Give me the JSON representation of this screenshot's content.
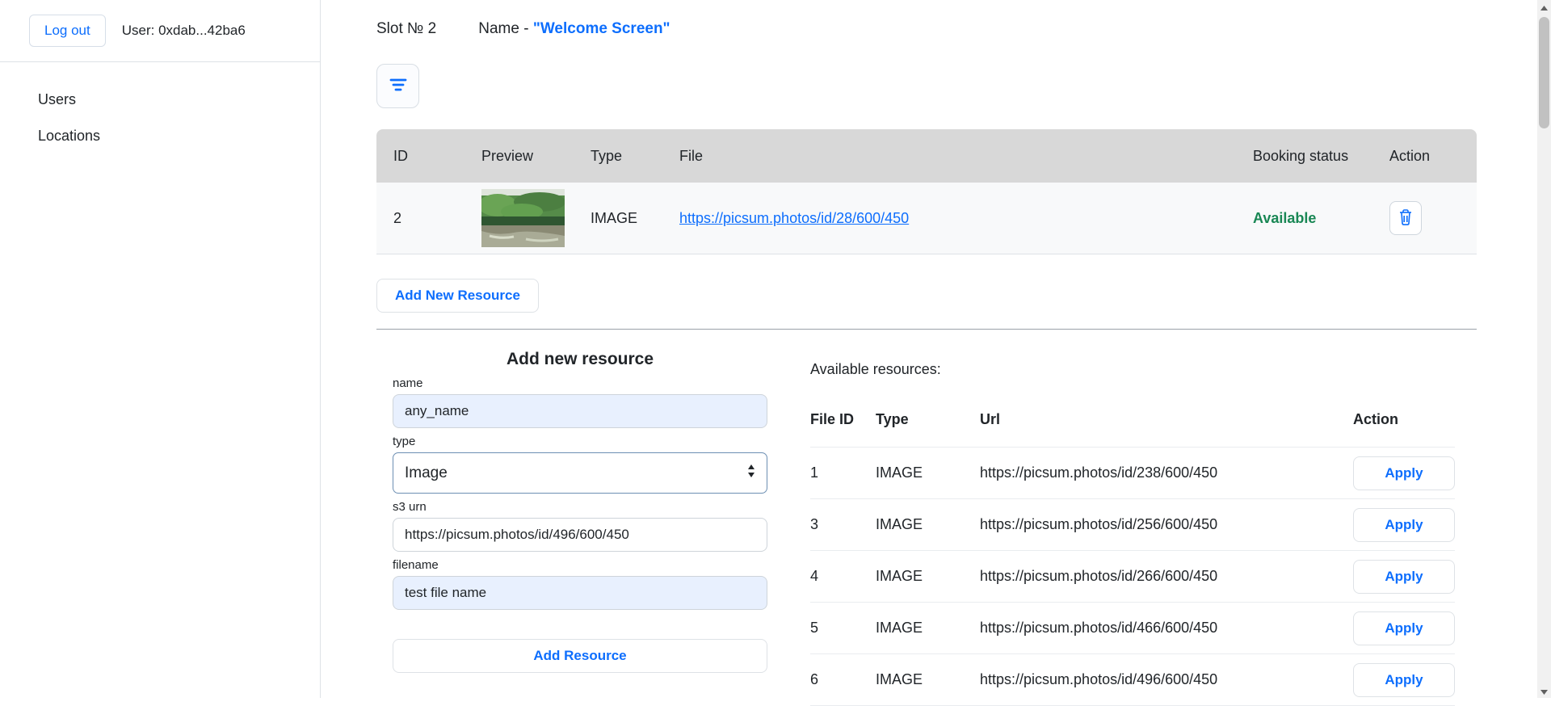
{
  "sidebar": {
    "logout_label": "Log out",
    "user_label": "User: 0xdab...42ba6",
    "items": [
      {
        "label": "Users"
      },
      {
        "label": "Locations"
      }
    ]
  },
  "header": {
    "slot_label": "Slot № 2",
    "name_prefix": "Name - ",
    "name_value": "\"Welcome Screen\""
  },
  "slot_table": {
    "headers": [
      "ID",
      "Preview",
      "Type",
      "File",
      "Booking status",
      "Action"
    ],
    "rows": [
      {
        "id": "2",
        "preview_alt": "forest river photo",
        "type": "IMAGE",
        "file": "https://picsum.photos/id/28/600/450",
        "status": "Available"
      }
    ]
  },
  "actions": {
    "add_new_resource_label": "Add New Resource"
  },
  "form": {
    "title": "Add new resource",
    "name_label": "name",
    "name_value": "any_name",
    "type_label": "type",
    "type_value": "Image",
    "s3_label": "s3 urn",
    "s3_value": "https://picsum.photos/id/496/600/450",
    "filename_label": "filename",
    "filename_value": "test file name",
    "submit_label": "Add Resource"
  },
  "available": {
    "title": "Available resources:",
    "headers": [
      "File ID",
      "Type",
      "Url",
      "Action"
    ],
    "apply_label": "Apply",
    "rows": [
      {
        "file_id": "1",
        "type": "IMAGE",
        "url": "https://picsum.photos/id/238/600/450"
      },
      {
        "file_id": "3",
        "type": "IMAGE",
        "url": "https://picsum.photos/id/256/600/450"
      },
      {
        "file_id": "4",
        "type": "IMAGE",
        "url": "https://picsum.photos/id/266/600/450"
      },
      {
        "file_id": "5",
        "type": "IMAGE",
        "url": "https://picsum.photos/id/466/600/450"
      },
      {
        "file_id": "6",
        "type": "IMAGE",
        "url": "https://picsum.photos/id/496/600/450"
      }
    ]
  },
  "icons": {
    "filter_icon": "three horizontal lines",
    "trash_icon": "trash can outline",
    "select_arrows_icon": "up-down triangles",
    "scroll_up_icon": "▲",
    "scroll_down_icon": "▼"
  },
  "colors": {
    "accent": "#0d6efd",
    "link": "#0d6efd",
    "status_available": "#198754",
    "table_header_bg": "#d8d8d8",
    "row_bg": "#f8f9fa",
    "autofill_bg": "#e8f0fe",
    "border": "#dee2e6"
  }
}
